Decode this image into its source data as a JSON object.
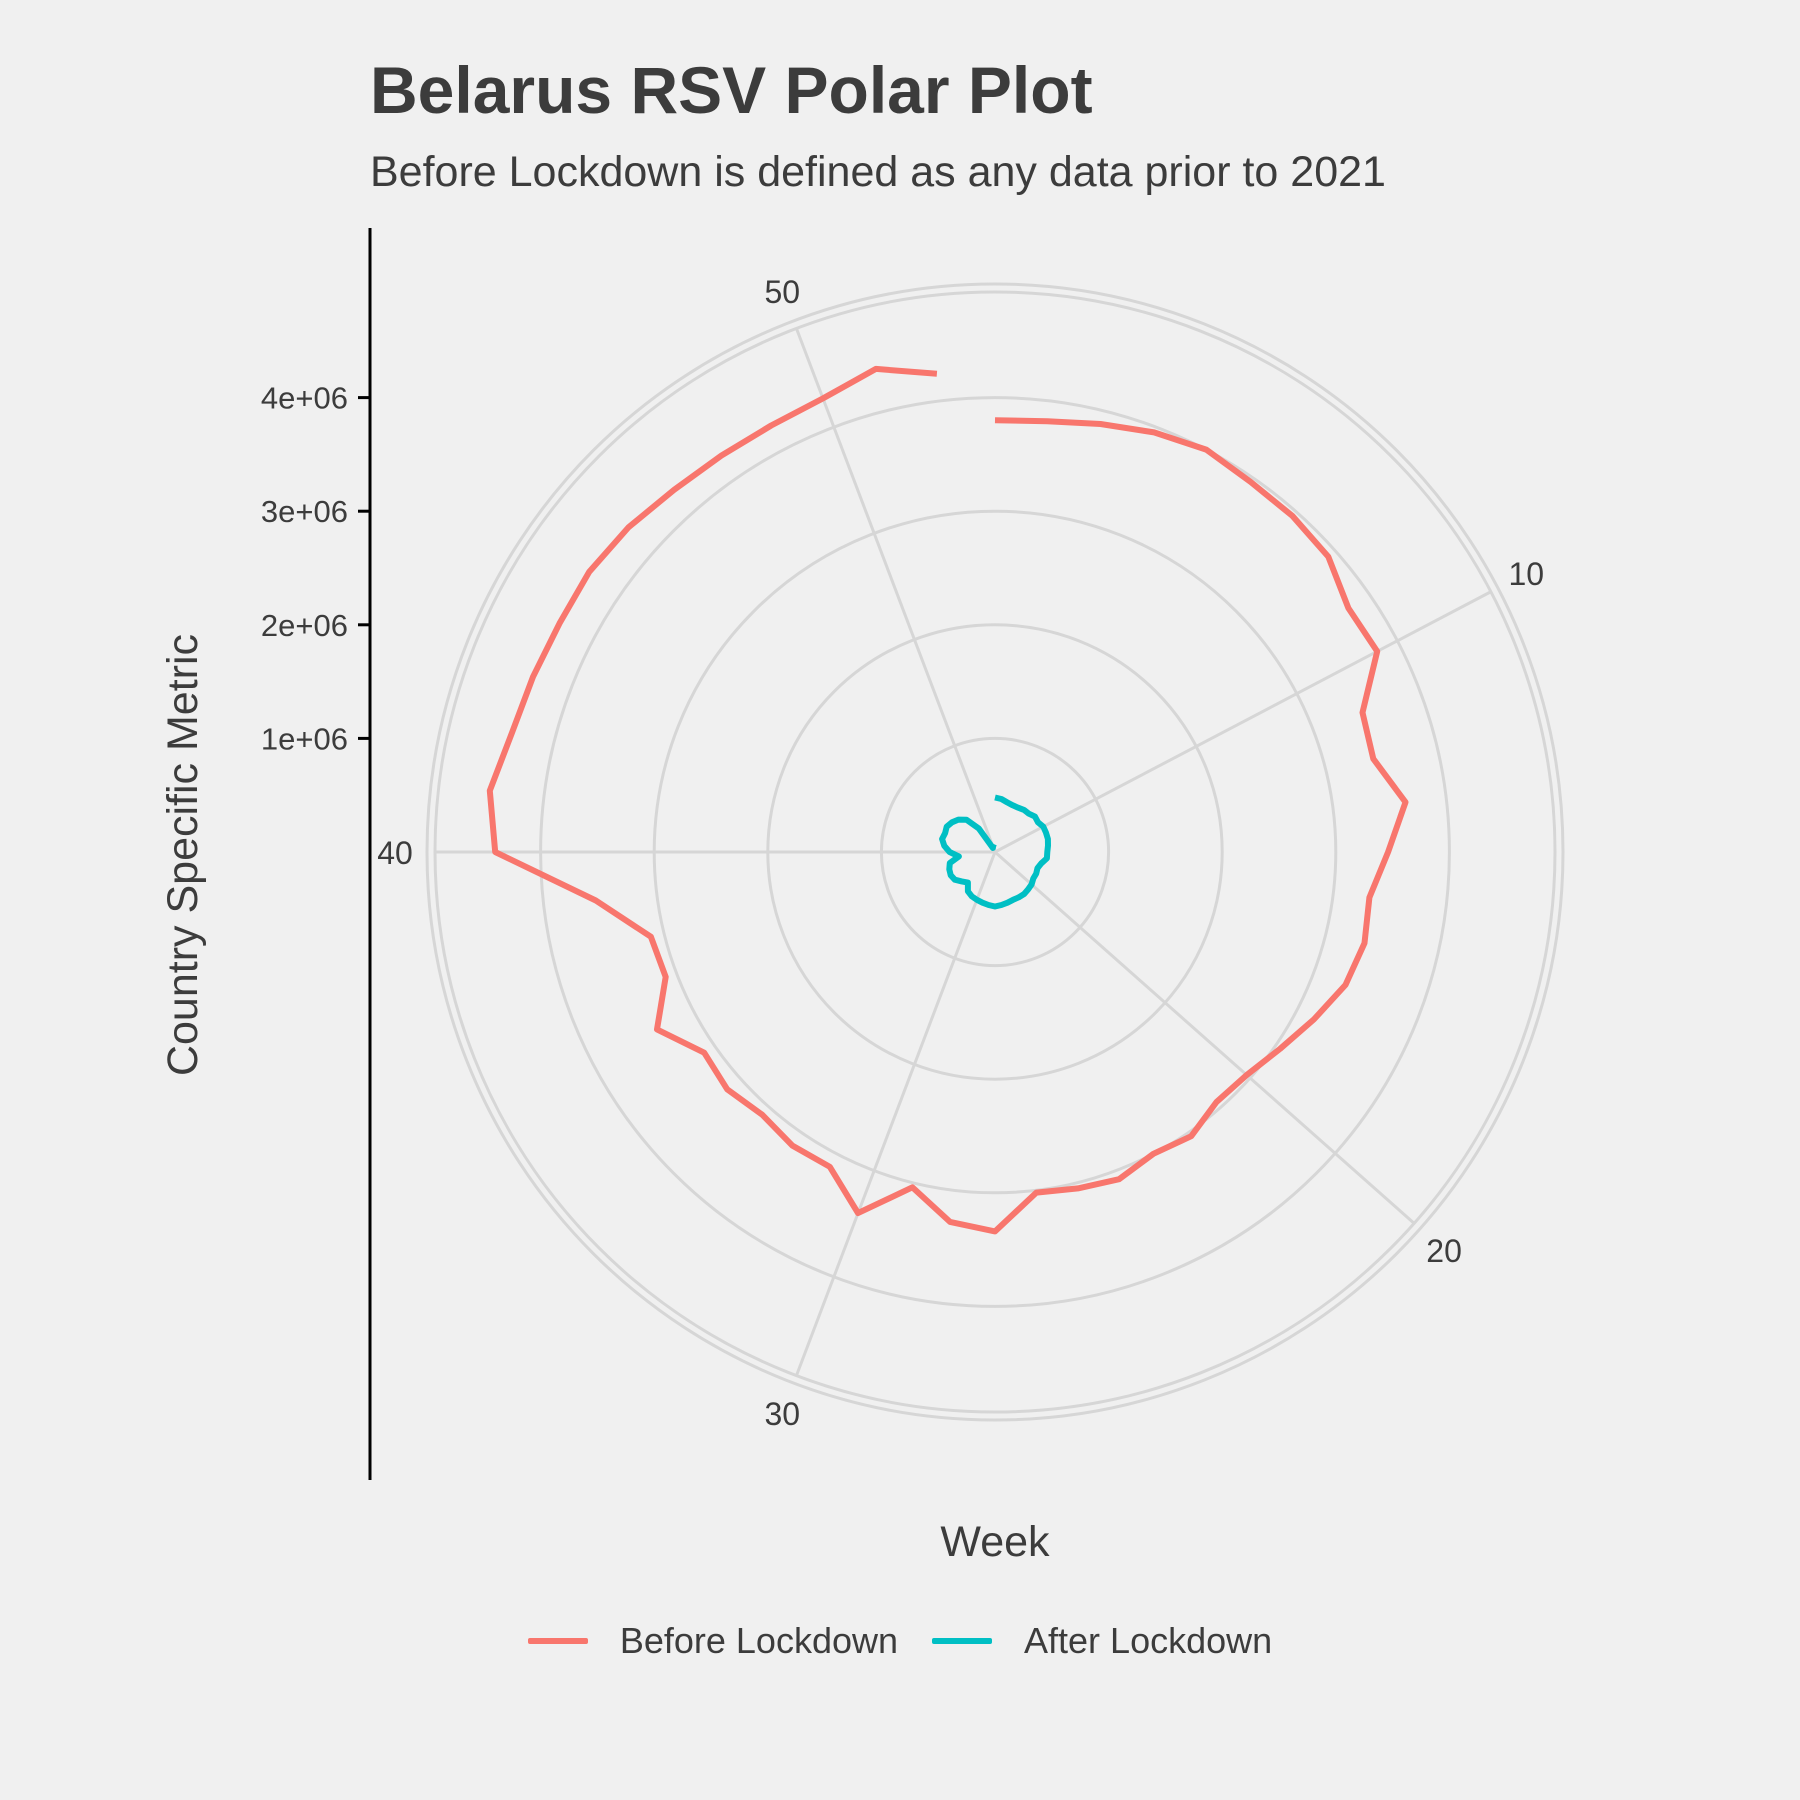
{
  "chart_data": {
    "type": "line",
    "coord": "polar",
    "title": "Belarus RSV Polar Plot",
    "subtitle": "Before Lockdown is defined as any data prior to 2021",
    "xlabel": "Week",
    "ylabel": "Country Specific Metric",
    "x_ticks": [
      "10",
      "20",
      "30",
      "40",
      "50"
    ],
    "y_ticks": [
      "1e+06",
      "2e+06",
      "3e+06",
      "4e+06"
    ],
    "ylim": [
      0,
      5000000
    ],
    "grid": true,
    "legend_position": "bottom",
    "series": [
      {
        "name": "Before Lockdown",
        "color": "#F8766D",
        "x": [
          1,
          2,
          3,
          4,
          5,
          6,
          7,
          8,
          9,
          10,
          11,
          12,
          13,
          14,
          15,
          16,
          17,
          18,
          19,
          20,
          21,
          22,
          23,
          24,
          25,
          26,
          27,
          28,
          29,
          30,
          31,
          32,
          33,
          34,
          35,
          36,
          37,
          38,
          39,
          40,
          41,
          42,
          43,
          44,
          45,
          46,
          47,
          48,
          49,
          50,
          51,
          52
        ],
        "values": [
          3800000,
          3820000,
          3880000,
          3950000,
          4000000,
          3960000,
          3950000,
          3920000,
          3780000,
          3800000,
          3460000,
          3430000,
          3640000,
          3460000,
          3320000,
          3350000,
          3300000,
          3170000,
          3050000,
          2960000,
          2940000,
          3040000,
          3000000,
          3080000,
          3050000,
          3020000,
          3340000,
          3280000,
          3040000,
          3400000,
          3130000,
          3140000,
          3090000,
          3150000,
          3110000,
          3360000,
          3100000,
          3120000,
          3540000,
          4400000,
          4480000,
          4380000,
          4350000,
          4330000,
          4340000,
          4310000,
          4260000,
          4240000,
          4240000,
          4270000,
          4380000,
          4240000
        ]
      },
      {
        "name": "After Lockdown",
        "color": "#00BFC4",
        "x": [
          1,
          2,
          3,
          4,
          5,
          6,
          7,
          8,
          9,
          10,
          11,
          12,
          13,
          14,
          15,
          16,
          17,
          18,
          19,
          20,
          21,
          22,
          23,
          24,
          25,
          26,
          27,
          28,
          29,
          30,
          31,
          32,
          33,
          34,
          35,
          36,
          37,
          38,
          39,
          40,
          41,
          42,
          43,
          44,
          45,
          46,
          47,
          48,
          49,
          50,
          51,
          52
        ],
        "values": [
          480000,
          470000,
          450000,
          440000,
          440000,
          450000,
          450000,
          470000,
          460000,
          480000,
          480000,
          480000,
          470000,
          460000,
          460000,
          420000,
          400000,
          410000,
          410000,
          430000,
          440000,
          450000,
          450000,
          450000,
          460000,
          470000,
          480000,
          470000,
          460000,
          450000,
          440000,
          420000,
          360000,
          390000,
          430000,
          440000,
          430000,
          410000,
          320000,
          400000,
          450000,
          480000,
          470000,
          480000,
          460000,
          430000,
          380000,
          250000,
          40000,
          50000,
          60000,
          70000
        ]
      }
    ]
  }
}
